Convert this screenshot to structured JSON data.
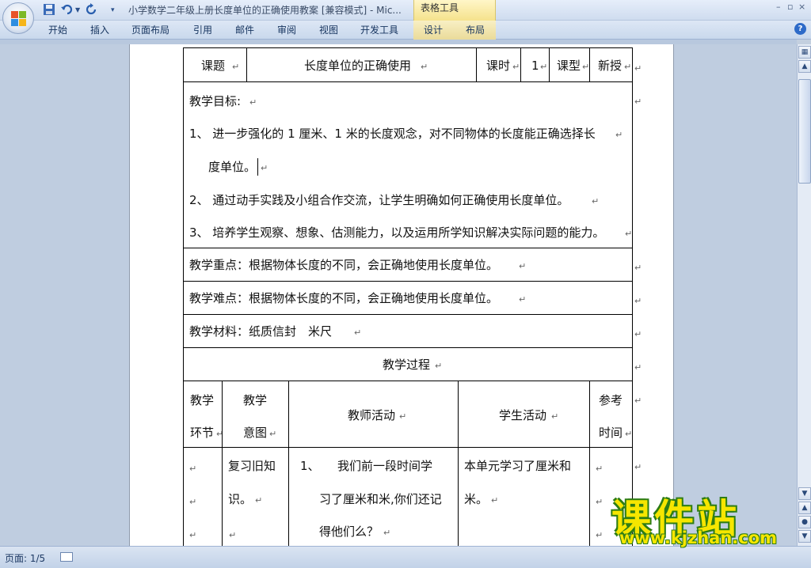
{
  "window": {
    "title": "小学数学二年级上册长度单位的正确使用教案 [兼容模式] - Mic...",
    "context_tab_group": "表格工具",
    "controls": [
      "–",
      "▫",
      "×"
    ]
  },
  "ribbon": {
    "tabs": [
      "开始",
      "插入",
      "页面布局",
      "引用",
      "邮件",
      "审阅",
      "视图",
      "开发工具",
      "设计",
      "布局"
    ]
  },
  "table": {
    "header": {
      "topic_label": "课题",
      "topic_value": "长度单位的正确使用",
      "hours_label": "课时",
      "hours_value": "1",
      "type_label": "课型",
      "type_value": "新授"
    },
    "objectives": {
      "heading": "教学目标:",
      "items": [
        "1、 进一步强化的 1 厘米、1 米的长度观念，对不同物体的长度能正确选择长",
        "度单位。",
        "2、 通过动手实践及小组合作交流，让学生明确如何正确使用长度单位。",
        "3、 培养学生观察、想象、估测能力，以及运用所学知识解决实际问题的能力。"
      ]
    },
    "key_point": "教学重点：根据物体长度的不同，会正确地使用长度单位。",
    "difficulty": "教学难点：根据物体长度的不同，会正确地使用长度单位。",
    "materials": "教学材料：纸质信封　米尺",
    "process_title": "教学过程",
    "process_headers": {
      "stage_l1": "教学",
      "stage_l2": "环节",
      "intent_l1": "教学",
      "intent_l2": "意图",
      "teacher": "教师活动",
      "student": "学生活动",
      "time_l1": "参考",
      "time_l2": "时间"
    },
    "row1": {
      "intent_l1": "复习旧知",
      "intent_l2": "识。",
      "teacher_l1": "1、　　我们前一段时间学",
      "teacher_l2": "习了厘米和米,你们还记",
      "teacher_l3": "得他们么？",
      "student_l1": "本单元学习了厘米和",
      "student_l2": "米。"
    },
    "para_mark": "↵"
  },
  "status": {
    "page": "页面: 1/5"
  },
  "watermark": {
    "chinese": "课件站",
    "url": "www.kjzhan.com"
  }
}
